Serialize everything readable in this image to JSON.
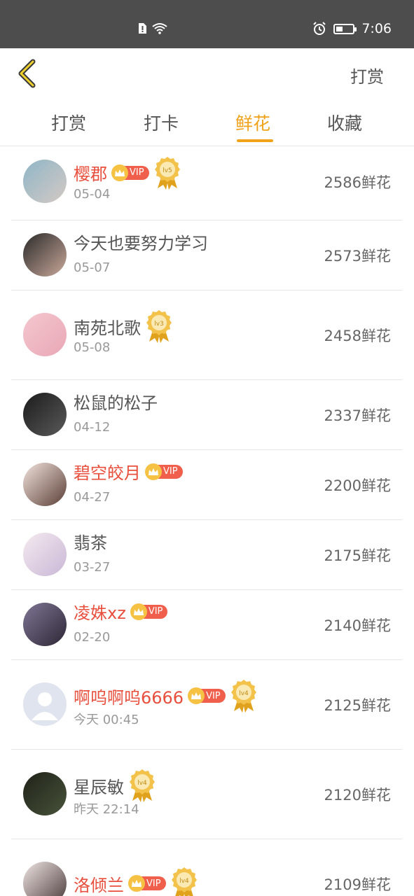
{
  "status_bar": {
    "time": "7:06"
  },
  "header": {
    "title": "打赏"
  },
  "tabs": [
    {
      "label": "打赏",
      "active": false
    },
    {
      "label": "打卡",
      "active": false
    },
    {
      "label": "鲜花",
      "active": true
    },
    {
      "label": "收藏",
      "active": false
    }
  ],
  "colors": {
    "accent": "#f0a31a",
    "vip_name": "#e84f3d",
    "status_bar": "#4d4d4d"
  },
  "vip_label": "VIP",
  "rows": [
    {
      "name": "樱郡",
      "vip": true,
      "level": "lv5",
      "date": "05-04",
      "count": "2586鲜花"
    },
    {
      "name": "今天也要努力学习",
      "vip": false,
      "level": "",
      "date": "05-07",
      "count": "2573鲜花"
    },
    {
      "name": "南苑北歌",
      "vip": false,
      "level": "lv3",
      "date": "05-08",
      "count": "2458鲜花"
    },
    {
      "name": "松鼠的松子",
      "vip": false,
      "level": "",
      "date": "04-12",
      "count": "2337鲜花"
    },
    {
      "name": "碧空皎月",
      "vip": true,
      "level": "",
      "date": "04-27",
      "count": "2200鲜花"
    },
    {
      "name": "翡茶",
      "vip": false,
      "level": "",
      "date": "03-27",
      "count": "2175鲜花"
    },
    {
      "name": "凌姝xz",
      "vip": true,
      "level": "",
      "date": "02-20",
      "count": "2140鲜花"
    },
    {
      "name": "啊呜啊呜6666",
      "vip": true,
      "level": "lv4",
      "date": "今天 00:45",
      "count": "2125鲜花"
    },
    {
      "name": "星辰敏",
      "vip": false,
      "level": "lv4",
      "date": "昨天 22:14",
      "count": "2120鲜花"
    },
    {
      "name": "洛倾兰",
      "vip": true,
      "level": "lv4",
      "date": "",
      "count": "2109鲜花"
    }
  ]
}
